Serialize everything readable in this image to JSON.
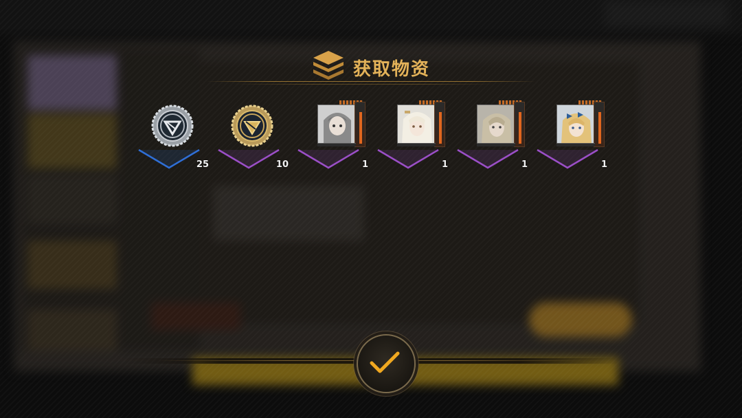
{
  "dialog": {
    "title": "获取物资",
    "title_color": "#e3b259"
  },
  "rewards": [
    {
      "icon": "silver-token-icon",
      "rarity_color": "#2f6fd6",
      "count": "25"
    },
    {
      "icon": "gold-token-icon",
      "rarity_color": "#9b4fc7",
      "count": "10"
    },
    {
      "icon": "character-card-silver-hair-icon",
      "rarity_color": "#9b4fc7",
      "count": "1"
    },
    {
      "icon": "character-card-white-hair-icon",
      "rarity_color": "#9b4fc7",
      "count": "1"
    },
    {
      "icon": "character-card-ash-blonde-icon",
      "rarity_color": "#9b4fc7",
      "count": "1"
    },
    {
      "icon": "character-card-blonde-ribbon-icon",
      "rarity_color": "#9b4fc7",
      "count": "1"
    }
  ],
  "confirm": {
    "icon": "checkmark-icon",
    "accent_color": "#f0a820"
  }
}
